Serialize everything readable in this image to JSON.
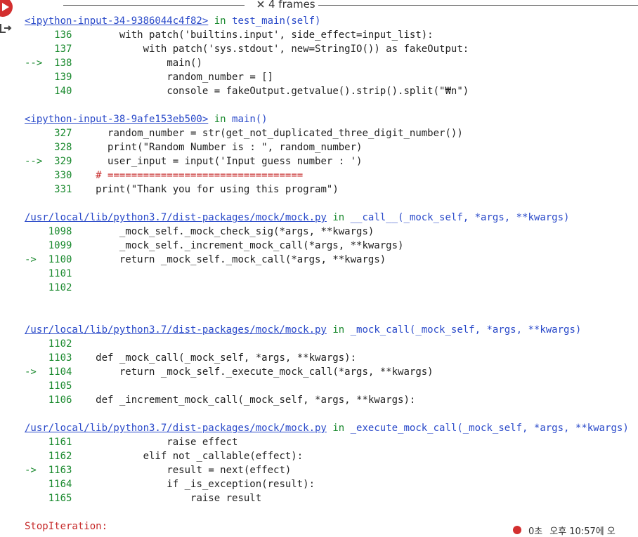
{
  "frames_label": "4 frames",
  "frames": [
    {
      "file": "<ipython-input-34-9386044c4f82>",
      "in": "in",
      "func": "test_main(self)",
      "lines": [
        {
          "num": "136",
          "arrow": "",
          "code": "        with patch('builtins.input', side_effect=input_list):"
        },
        {
          "num": "137",
          "arrow": "",
          "code": "            with patch('sys.stdout', new=StringIO()) as fakeOutput:"
        },
        {
          "num": "138",
          "arrow": "--> ",
          "code": "                main()"
        },
        {
          "num": "139",
          "arrow": "",
          "code": "                random_number = []"
        },
        {
          "num": "140",
          "arrow": "",
          "code": "                console = fakeOutput.getvalue().strip().split(\"₩n\")"
        }
      ]
    },
    {
      "file": "<ipython-input-38-9afe153eb500>",
      "in": "in",
      "func": "main()",
      "lines": [
        {
          "num": "327",
          "arrow": "",
          "code": "      random_number = str(get_not_duplicated_three_digit_number())"
        },
        {
          "num": "328",
          "arrow": "",
          "code": "      print(\"Random Number is : \", random_number)"
        },
        {
          "num": "329",
          "arrow": "--> ",
          "code": "      user_input = input('Input guess number : ')"
        },
        {
          "num": "330",
          "arrow": "",
          "code": "    # =================================",
          "comment": true
        },
        {
          "num": "331",
          "arrow": "",
          "code": "    print(\"Thank you for using this program\")"
        }
      ]
    },
    {
      "file": "/usr/local/lib/python3.7/dist-packages/mock/mock.py",
      "in": "in",
      "func": "__call__(_mock_self, *args, **kwargs)",
      "lines": [
        {
          "num": "1098",
          "arrow": "",
          "code": "        _mock_self._mock_check_sig(*args, **kwargs)"
        },
        {
          "num": "1099",
          "arrow": "",
          "code": "        _mock_self._increment_mock_call(*args, **kwargs)"
        },
        {
          "num": "1100",
          "arrow": "-> ",
          "code": "        return _mock_self._mock_call(*args, **kwargs)"
        },
        {
          "num": "1101",
          "arrow": "",
          "code": ""
        },
        {
          "num": "1102",
          "arrow": "",
          "code": ""
        }
      ]
    },
    {
      "file": "/usr/local/lib/python3.7/dist-packages/mock/mock.py",
      "in": "in",
      "func": "_mock_call(_mock_self, *args, **kwargs)",
      "lines": [
        {
          "num": "1102",
          "arrow": "",
          "code": ""
        },
        {
          "num": "1103",
          "arrow": "",
          "code": "    def _mock_call(_mock_self, *args, **kwargs):"
        },
        {
          "num": "1104",
          "arrow": "-> ",
          "code": "        return _mock_self._execute_mock_call(*args, **kwargs)"
        },
        {
          "num": "1105",
          "arrow": "",
          "code": ""
        },
        {
          "num": "1106",
          "arrow": "",
          "code": "    def _increment_mock_call(_mock_self, *args, **kwargs):"
        }
      ]
    },
    {
      "file": "/usr/local/lib/python3.7/dist-packages/mock/mock.py",
      "in": "in",
      "func": "_execute_mock_call(_mock_self, *args, **kwargs)",
      "lines": [
        {
          "num": "1161",
          "arrow": "",
          "code": "                raise effect"
        },
        {
          "num": "1162",
          "arrow": "",
          "code": "            elif not _callable(effect):"
        },
        {
          "num": "1163",
          "arrow": "-> ",
          "code": "                result = next(effect)"
        },
        {
          "num": "1164",
          "arrow": "",
          "code": "                if _is_exception(result):"
        },
        {
          "num": "1165",
          "arrow": "",
          "code": "                    raise result"
        }
      ]
    }
  ],
  "error": "StopIteration:",
  "status": {
    "left": "0초",
    "right": "오후 10:57에 오"
  }
}
